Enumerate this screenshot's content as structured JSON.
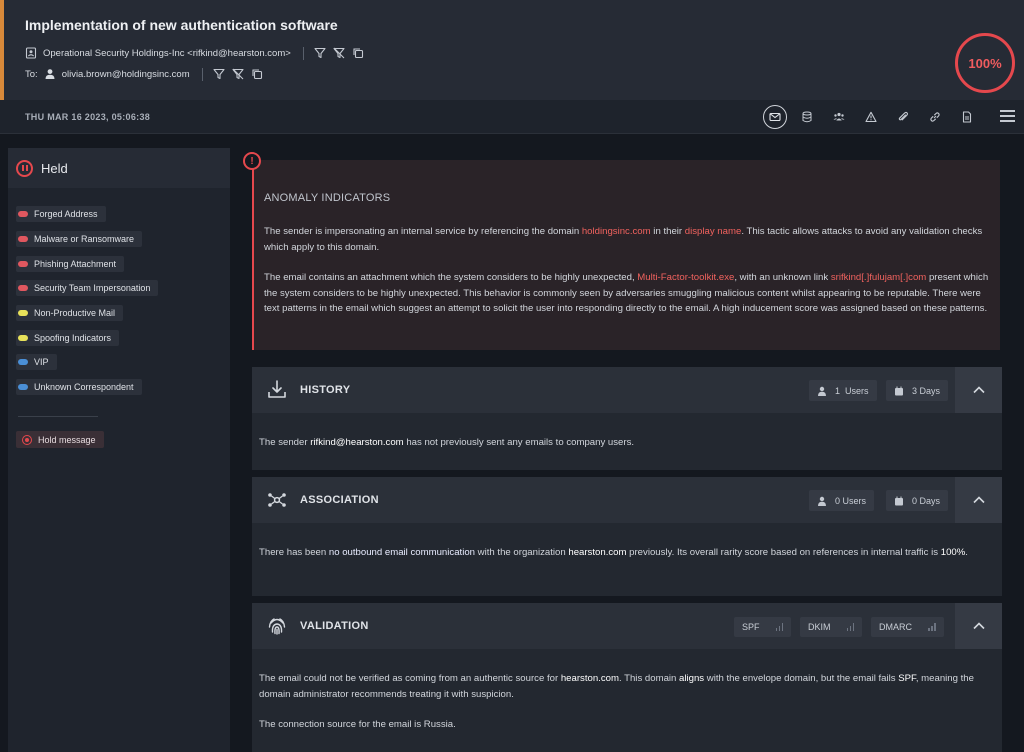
{
  "header": {
    "title": "Implementation of new authentication software",
    "from": "Operational Security Holdings-Inc <rifkind@hearston.com>",
    "to_label": "To:",
    "to": "olivia.brown@holdingsinc.com",
    "score": "100%",
    "accent_color": "#d7893a",
    "score_color": "#e5484d"
  },
  "toolbar": {
    "date": "THU MAR 16 2023, 05:06:38",
    "icons": [
      "envelope-icon",
      "database-icon",
      "users-icon",
      "warning-icon",
      "paperclip-icon",
      "link-icon",
      "document-icon",
      "menu-icon"
    ]
  },
  "sidebar": {
    "status": "Held",
    "tags": [
      {
        "label": "Forged Address",
        "color": "#e0575f"
      },
      {
        "label": "Malware or Ransomware",
        "color": "#e0575f"
      },
      {
        "label": "Phishing Attachment",
        "color": "#e0575f"
      },
      {
        "label": "Security Team Impersonation",
        "color": "#e0575f"
      },
      {
        "label": "Non-Productive Mail",
        "color": "#e8e25a"
      },
      {
        "label": "Spoofing Indicators",
        "color": "#e8e25a"
      },
      {
        "label": "VIP",
        "color": "#4a8fd6"
      },
      {
        "label": "Unknown Correspondent",
        "color": "#4a8fd6"
      }
    ],
    "hold_button": "Hold message"
  },
  "anomaly": {
    "title": "ANOMALY INDICATORS",
    "p1": {
      "a": "The sender is impersonating an internal service by referencing the domain ",
      "domain": "holdingsinc.com",
      "b": " in their ",
      "display": "display name",
      "c": ". This tactic allows attacks to avoid any validation checks which apply to this domain."
    },
    "p2": {
      "a": "The email contains an attachment which the system considers to be highly unexpected, ",
      "file": "Multi-Factor-toolkit.exe",
      "b": ", with an unknown link ",
      "link": "srifkind[.]fulujam[.]com",
      "c": " present which the system considers to be highly unexpected. This behavior is commonly seen by adversaries smuggling malicious content whilst appearing to be reputable. There were text patterns in the email which suggest an attempt to solicit the user into responding directly to the email. A high inducement score was assigned based on these patterns."
    }
  },
  "history": {
    "title": "HISTORY",
    "users_count": "1",
    "users_label": "Users",
    "days": "3 Days",
    "body": {
      "a": "The sender ",
      "sender": "rifkind@hearston.com",
      "b": " has not previously sent any emails to company users."
    }
  },
  "association": {
    "title": "ASSOCIATION",
    "users": "0 Users",
    "days": "0 Days",
    "body": {
      "a": "There has been ",
      "no_comm": "no outbound email communication",
      "b": " with the organization ",
      "org": "hearston.com",
      "c": " previously. Its overall rarity score based on references in internal traffic is ",
      "score": "100%",
      "d": "."
    }
  },
  "validation": {
    "title": "VALIDATION",
    "badges": [
      "SPF",
      "DKIM",
      "DMARC"
    ],
    "body": {
      "a": "The email could not be verified as coming from an authentic source for ",
      "domain": "hearston.com",
      "b": ". This domain ",
      "aligns": "aligns",
      "c": " with the envelope domain, but the email fails ",
      "spf": "SPF",
      "d": ", meaning the domain administrator recommends treating it with suspicion.",
      "p2": "The connection source for the email is Russia."
    }
  }
}
